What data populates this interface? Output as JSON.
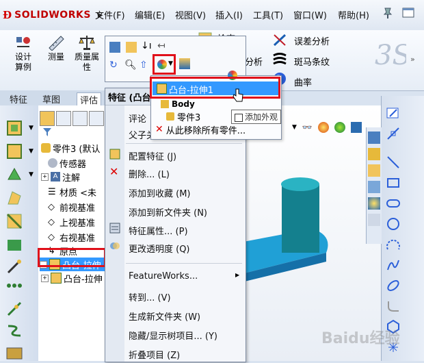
{
  "app": {
    "brand": "SOLIDWORKS"
  },
  "menu": [
    "文件(F)",
    "编辑(E)",
    "视图(V)",
    "插入(I)",
    "工具(T)",
    "窗口(W)",
    "帮助(H)"
  ],
  "ribbon": {
    "big_buttons": [
      "设计算例",
      "测量",
      "质量属性"
    ],
    "check": "检查",
    "analysis": "分析",
    "right_tools": [
      "误差分析",
      "斑马条纹",
      "曲率"
    ]
  },
  "cmd_tabs": [
    "特征",
    "草图",
    "评估"
  ],
  "tree": {
    "items": [
      "零件3 (默认",
      "传感器",
      "注解",
      "材质 <未",
      "前视基准",
      "上视基准",
      "右视基准",
      "原点",
      "凸台-拉伸",
      "凸台-拉伸"
    ]
  },
  "context_menu": {
    "header": "特征 (凸台",
    "items": [
      "评论",
      "父子关",
      "配置特征 (J)",
      "删除... (L)",
      "添加到收藏 (M)",
      "添加到新文件夹 (N)",
      "特征属性... (P)",
      "更改透明度 (Q)",
      "FeatureWorks...",
      "转到... (V)",
      "生成新文件夹 (W)",
      "隐藏/显示树项目... (Y)",
      "折叠项目 (Z)"
    ]
  },
  "submenu": {
    "items": [
      "凸台-拉伸1",
      "Body",
      "零件3",
      "从此移除所有零件..."
    ]
  },
  "tooltip": "添加外观",
  "watermark": "Baidu经验",
  "colors": {
    "highlight": "#3399ff",
    "red_box": "#e0101a",
    "model": "#1f9aa8"
  }
}
